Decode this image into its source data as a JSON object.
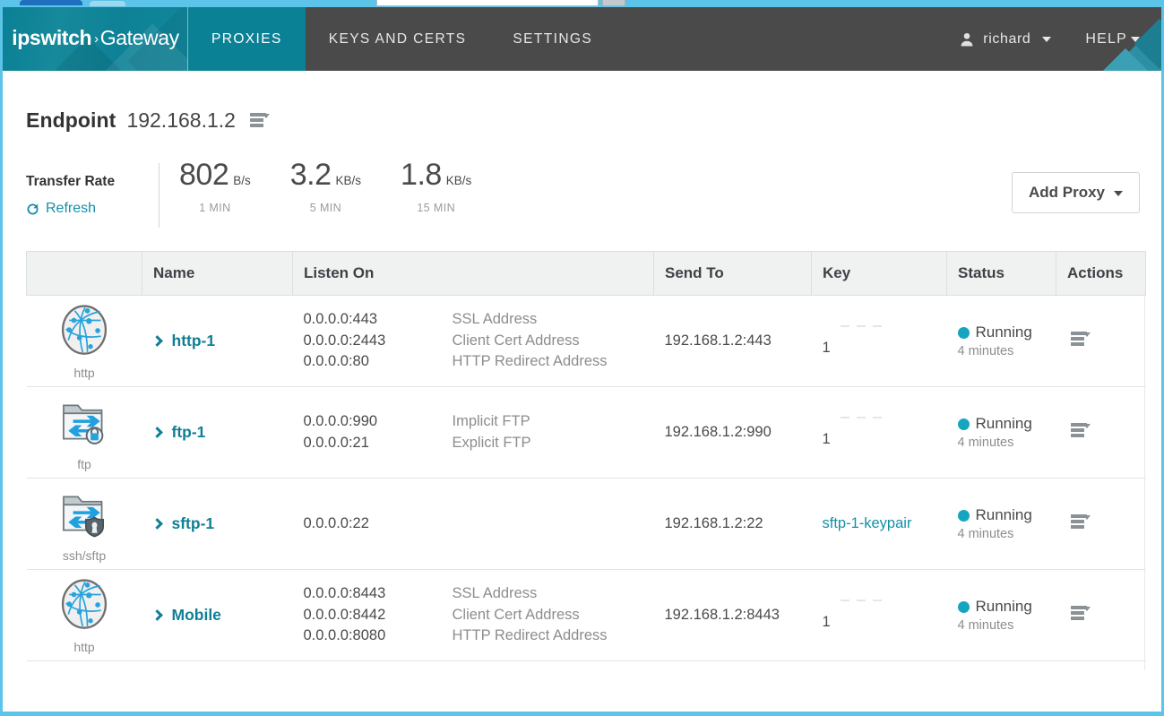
{
  "browser": {
    "tab_strip": "browser-tab-strip",
    "address_bar": "address-bar",
    "toolbar_button": "toolbar-button"
  },
  "header": {
    "brand_primary": "ipswitch",
    "brand_arrow": "›",
    "brand_secondary": "Gateway",
    "nav": [
      {
        "label": "PROXIES",
        "active": true
      },
      {
        "label": "KEYS AND CERTS",
        "active": false
      },
      {
        "label": "SETTINGS",
        "active": false
      }
    ],
    "user": {
      "icon": "user-icon",
      "name": "richard",
      "caret": "caret-down-icon"
    },
    "help": {
      "label": "HELP",
      "caret": "caret-down-icon"
    },
    "accent_teal": "#0b8195",
    "bar_gray": "#4a4a4a"
  },
  "endpoint": {
    "label": "Endpoint",
    "value": "192.168.1.2",
    "menu_icon": "list-menu-icon"
  },
  "transfer": {
    "title": "Transfer Rate",
    "refresh_label": "Refresh",
    "refresh_icon": "refresh-icon",
    "stats": [
      {
        "value": "802",
        "unit": "B/s",
        "period": "1 MIN"
      },
      {
        "value": "3.2",
        "unit": "KB/s",
        "period": "5 MIN"
      },
      {
        "value": "1.8",
        "unit": "KB/s",
        "period": "15 MIN"
      }
    ]
  },
  "toolbar": {
    "add_proxy_label": "Add Proxy"
  },
  "table": {
    "columns": {
      "icon": "",
      "name": "Name",
      "listen_on": "Listen On",
      "send_to": "Send To",
      "key": "Key",
      "status": "Status",
      "actions": "Actions"
    },
    "rows": [
      {
        "proto_icon": "globe-network-icon",
        "proto_label": "http",
        "name": "http-1",
        "listen_addresses": [
          "0.0.0.0:443",
          "0.0.0.0:2443",
          "0.0.0.0:80"
        ],
        "listen_kinds": [
          "SSL Address",
          "Client Cert Address",
          "HTTP Redirect Address"
        ],
        "send_to": "192.168.1.2:443",
        "key": "1",
        "key_is_link": false,
        "status": "Running",
        "status_since": "4 minutes",
        "status_color": "#16a5c0",
        "actions_icon": "row-actions-icon"
      },
      {
        "proto_icon": "folder-transfer-lock-icon",
        "proto_label": "ftp",
        "name": "ftp-1",
        "listen_addresses": [
          "0.0.0.0:990",
          "0.0.0.0:21"
        ],
        "listen_kinds": [
          "Implicit FTP",
          "Explicit FTP"
        ],
        "send_to": "192.168.1.2:990",
        "key": "1",
        "key_is_link": false,
        "status": "Running",
        "status_since": "4 minutes",
        "status_color": "#16a5c0",
        "actions_icon": "row-actions-icon"
      },
      {
        "proto_icon": "folder-transfer-shield-icon",
        "proto_label": "ssh/sftp",
        "name": "sftp-1",
        "listen_addresses": [
          "0.0.0.0:22"
        ],
        "listen_kinds": [],
        "send_to": "192.168.1.2:22",
        "key": "sftp-1-keypair",
        "key_is_link": true,
        "status": "Running",
        "status_since": "4 minutes",
        "status_color": "#16a5c0",
        "actions_icon": "row-actions-icon"
      },
      {
        "proto_icon": "globe-network-icon",
        "proto_label": "http",
        "name": "Mobile",
        "listen_addresses": [
          "0.0.0.0:8443",
          "0.0.0.0:8442",
          "0.0.0.0:8080"
        ],
        "listen_kinds": [
          "SSL Address",
          "Client Cert Address",
          "HTTP Redirect Address"
        ],
        "send_to": "192.168.1.2:8443",
        "key": "1",
        "key_is_link": false,
        "status": "Running",
        "status_since": "4 minutes",
        "status_color": "#16a5c0",
        "actions_icon": "row-actions-icon"
      }
    ]
  }
}
